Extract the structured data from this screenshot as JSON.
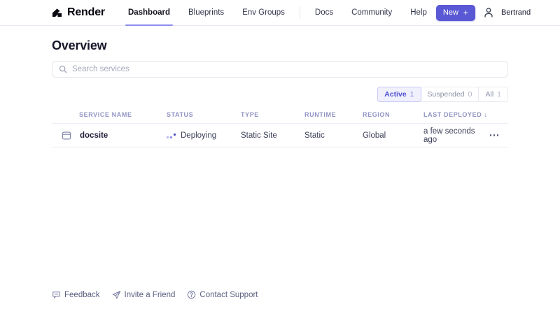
{
  "brand": {
    "name": "Render"
  },
  "nav": {
    "links": [
      {
        "label": "Dashboard"
      },
      {
        "label": "Blueprints"
      },
      {
        "label": "Env Groups"
      },
      {
        "label": "Docs"
      },
      {
        "label": "Community"
      },
      {
        "label": "Help"
      }
    ],
    "new_button": {
      "label": "New",
      "plus": "+"
    },
    "user_name": "Bertrand"
  },
  "page": {
    "title": "Overview"
  },
  "search": {
    "placeholder": "Search services"
  },
  "filters": [
    {
      "label": "Active",
      "count": "1"
    },
    {
      "label": "Suspended",
      "count": "0"
    },
    {
      "label": "All",
      "count": "1"
    }
  ],
  "table": {
    "headers": {
      "service_name": "SERVICE NAME",
      "status": "STATUS",
      "type": "TYPE",
      "runtime": "RUNTIME",
      "region": "REGION",
      "last_deployed": "LAST DEPLOYED"
    },
    "sort_arrow": "↓",
    "rows": [
      {
        "service_name": "docsite",
        "status": "Deploying",
        "type": "Static Site",
        "runtime": "Static",
        "region": "Global",
        "last_deployed": "a few seconds ago"
      }
    ]
  },
  "footer": {
    "links": [
      {
        "label": "Feedback"
      },
      {
        "label": "Invite a Friend"
      },
      {
        "label": "Contact Support"
      }
    ]
  },
  "colors": {
    "accent": "#5a58d5",
    "active_tab_underline": "#8d8cf0",
    "table_header_text": "#9094c4",
    "status_dot": "#4643cf"
  }
}
